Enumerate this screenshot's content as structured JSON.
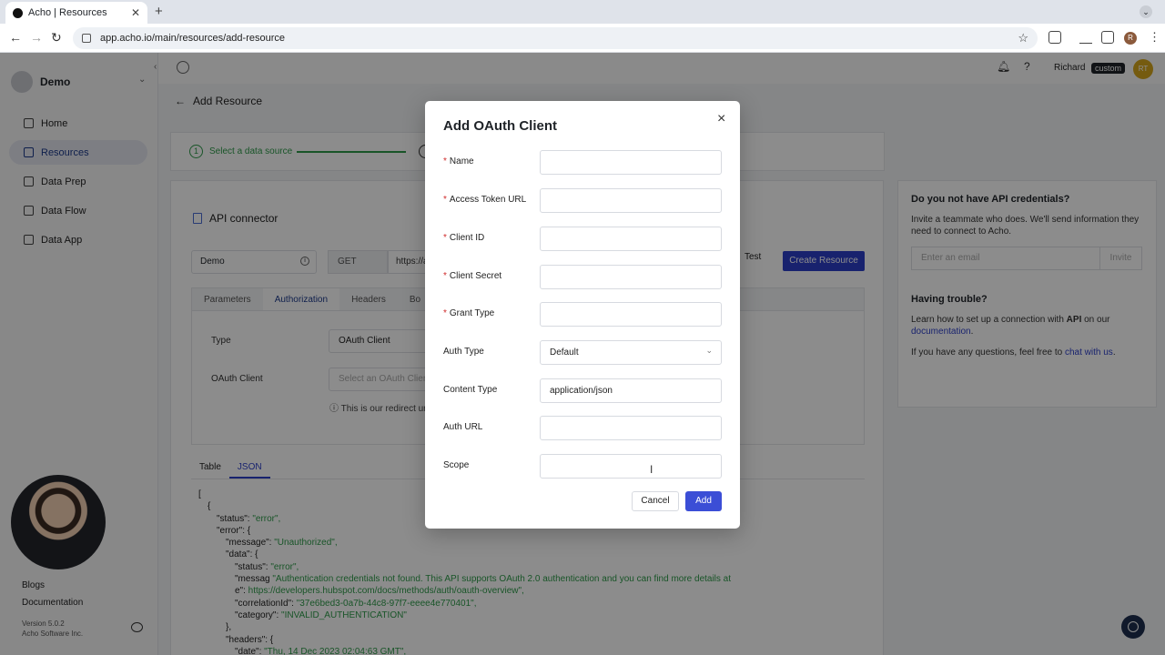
{
  "browser": {
    "tab_title": "Acho | Resources",
    "tab_close": "✕",
    "new_tab": "+",
    "url": "app.acho.io/main/resources/add-resource",
    "profile_initial": "R",
    "back": "←",
    "forward": "→",
    "reload": "↻",
    "star": "☆",
    "menu": "⋮",
    "tab_menu": "⌄"
  },
  "sidebar": {
    "workspace": "Demo",
    "items": [
      {
        "label": "Home"
      },
      {
        "label": "Resources"
      },
      {
        "label": "Data Prep"
      },
      {
        "label": "Data Flow"
      },
      {
        "label": "Data App"
      }
    ],
    "links": [
      "Blogs",
      "Documentation"
    ],
    "version": "Version 5.0.2",
    "company": "Acho Software Inc."
  },
  "topbar": {
    "user_name": "Richard",
    "user_badge": "custom",
    "user_initials": "RT",
    "bell": "🔔︎",
    "help": "?"
  },
  "page": {
    "back_label": "Add Resource",
    "step1_num": "1",
    "step1_label": "Select a data source",
    "connector_title": "API connector",
    "connector_name": "Demo",
    "method": "GET",
    "url_partial": "https://a",
    "test_label": "Test",
    "create_label": "Create Resource",
    "subtabs": [
      "Parameters",
      "Authorization",
      "Headers",
      "Bo"
    ],
    "type_label": "Type",
    "type_value": "OAuth Client",
    "oauth_label": "OAuth Client",
    "oauth_placeholder": "Select an OAuth Client",
    "redirect_note": "ⓘ This is our redirect ur",
    "result_tabs": [
      "Table",
      "JSON"
    ]
  },
  "json_lines": [
    {
      "indent": 0,
      "key": "",
      "val": "[",
      "str": false
    },
    {
      "indent": 1,
      "key": "",
      "val": "{",
      "str": false
    },
    {
      "indent": 2,
      "key": "\"status\": ",
      "val": "\"error\",",
      "str": true
    },
    {
      "indent": 2,
      "key": "\"error\": ",
      "val": "{",
      "str": false
    },
    {
      "indent": 3,
      "key": "\"message\": ",
      "val": "\"Unauthorized\",",
      "str": true
    },
    {
      "indent": 3,
      "key": "\"data\": ",
      "val": "{",
      "str": false
    },
    {
      "indent": 4,
      "key": "\"status\": ",
      "val": "\"error\",",
      "str": true
    },
    {
      "indent": 4,
      "key": "\"messag ",
      "val": "\"Authentication credentials not found. This API supports OAuth 2.0 authentication and you can find more details at",
      "str": true
    },
    {
      "indent": 4,
      "key": "e\":        ",
      "val": "https://developers.hubspot.com/docs/methods/auth/oauth-overview\",",
      "str": true
    },
    {
      "indent": 4,
      "key": "\"correlationId\": ",
      "val": "\"37e6bed3-0a7b-44c8-97f7-eeee4e770401\",",
      "str": true
    },
    {
      "indent": 4,
      "key": "\"category\": ",
      "val": "\"INVALID_AUTHENTICATION\"",
      "str": true
    },
    {
      "indent": 3,
      "key": "",
      "val": "},",
      "str": false
    },
    {
      "indent": 3,
      "key": "\"headers\": ",
      "val": "{",
      "str": false
    },
    {
      "indent": 4,
      "key": "\"date\": ",
      "val": "\"Thu, 14 Dec 2023 02:04:63 GMT\",",
      "str": true
    }
  ],
  "right_panel": {
    "heading1": "Do you not have API credentials?",
    "text1": "Invite a teammate who does. We'll send information they need to connect to Acho.",
    "email_placeholder": "Enter an email",
    "invite_label": "Invite",
    "heading2": "Having trouble?",
    "text2_a": "Learn how to set up a connection with ",
    "text2_api": "API",
    "text2_b": " on our ",
    "text2_link": "documentation",
    "text2_c": ".",
    "text3_a": "If you have any questions, feel free to ",
    "text3_link": "chat with us",
    "text3_b": "."
  },
  "modal": {
    "title": "Add OAuth Client",
    "close": "×",
    "fields": [
      {
        "label": "Name",
        "required": true,
        "value": ""
      },
      {
        "label": "Access Token URL",
        "required": true,
        "value": ""
      },
      {
        "label": "Client ID",
        "required": true,
        "value": ""
      },
      {
        "label": "Client Secret",
        "required": true,
        "value": ""
      },
      {
        "label": "Grant Type",
        "required": true,
        "value": ""
      },
      {
        "label": "Auth Type",
        "required": false,
        "value": "Default"
      },
      {
        "label": "Content Type",
        "required": false,
        "value": "application/json"
      },
      {
        "label": "Auth URL",
        "required": false,
        "value": ""
      },
      {
        "label": "Scope",
        "required": false,
        "value": ""
      }
    ],
    "cancel_label": "Cancel",
    "add_label": "Add"
  },
  "colors": {
    "primary": "#2c3fc9",
    "success": "#2e9b4a",
    "required": "#d02b2b",
    "badge": "#1f2328"
  }
}
